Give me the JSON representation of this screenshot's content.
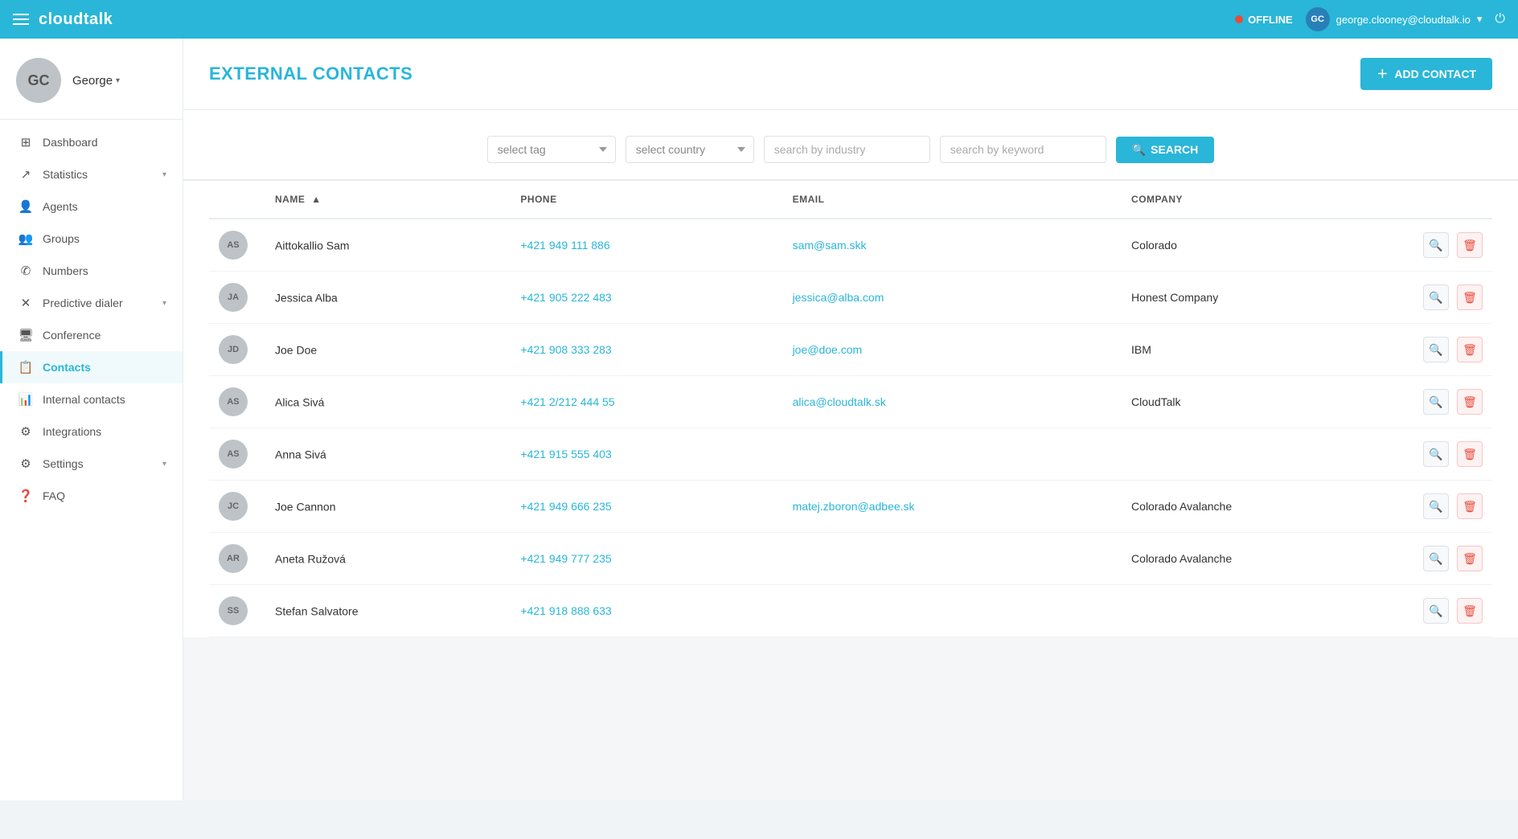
{
  "topnav": {
    "logo": "cloudtalk",
    "status": "OFFLINE",
    "user_email": "george.clooney@cloudtalk.io",
    "user_initials": "GC"
  },
  "sidebar": {
    "user_name": "George",
    "user_initials": "GC",
    "items": [
      {
        "label": "Dashboard",
        "icon": "grid",
        "active": false
      },
      {
        "label": "Statistics",
        "icon": "chart",
        "active": false,
        "has_arrow": true
      },
      {
        "label": "Agents",
        "icon": "person",
        "active": false
      },
      {
        "label": "Groups",
        "icon": "group",
        "active": false
      },
      {
        "label": "Numbers",
        "icon": "phone",
        "active": false
      },
      {
        "label": "Predictive dialer",
        "icon": "cross",
        "active": false,
        "has_arrow": true
      },
      {
        "label": "Conference",
        "icon": "screen",
        "active": false
      },
      {
        "label": "Contacts",
        "icon": "contact",
        "active": true
      },
      {
        "label": "Internal contacts",
        "icon": "internal",
        "active": false
      },
      {
        "label": "Integrations",
        "icon": "puzzle",
        "active": false
      },
      {
        "label": "Settings",
        "icon": "gear",
        "active": false,
        "has_arrow": true
      },
      {
        "label": "FAQ",
        "icon": "question",
        "active": false
      }
    ]
  },
  "page": {
    "title": "EXTERNAL CONTACTS",
    "add_button": "ADD CONTACT"
  },
  "filters": {
    "tag_placeholder": "select tag",
    "country_placeholder": "select country",
    "industry_placeholder": "search by industry",
    "keyword_placeholder": "search by keyword",
    "search_button": "SEARCH"
  },
  "table": {
    "columns": [
      "",
      "NAME",
      "PHONE",
      "EMAIL",
      "COMPANY",
      ""
    ],
    "rows": [
      {
        "initials": "AS",
        "name": "Aittokallio Sam",
        "phone": "+421 949 111 886",
        "email": "sam@sam.skk",
        "company": "Colorado"
      },
      {
        "initials": "JA",
        "name": "Jessica Alba",
        "phone": "+421 905 222 483",
        "email": "jessica@alba.com",
        "company": "Honest Company"
      },
      {
        "initials": "JD",
        "name": "Joe Doe",
        "phone": "+421 908 333 283",
        "email": "joe@doe.com",
        "company": "IBM"
      },
      {
        "initials": "AS",
        "name": "Alica Sivá",
        "phone": "+421 2/212 444 55",
        "email": "alica@cloudtalk.sk",
        "company": "CloudTalk"
      },
      {
        "initials": "AS",
        "name": "Anna Sivá",
        "phone": "+421 915 555 403",
        "email": "",
        "company": ""
      },
      {
        "initials": "JC",
        "name": "Joe Cannon",
        "phone": "+421 949 666 235",
        "email": "matej.zboron@adbee.sk",
        "company": "Colorado Avalanche"
      },
      {
        "initials": "AR",
        "name": "Aneta Ružová",
        "phone": "+421 949 777 235",
        "email": "",
        "company": "Colorado Avalanche"
      },
      {
        "initials": "SS",
        "name": "Stefan Salvatore",
        "phone": "+421 918 888 633",
        "email": "",
        "company": ""
      }
    ]
  }
}
